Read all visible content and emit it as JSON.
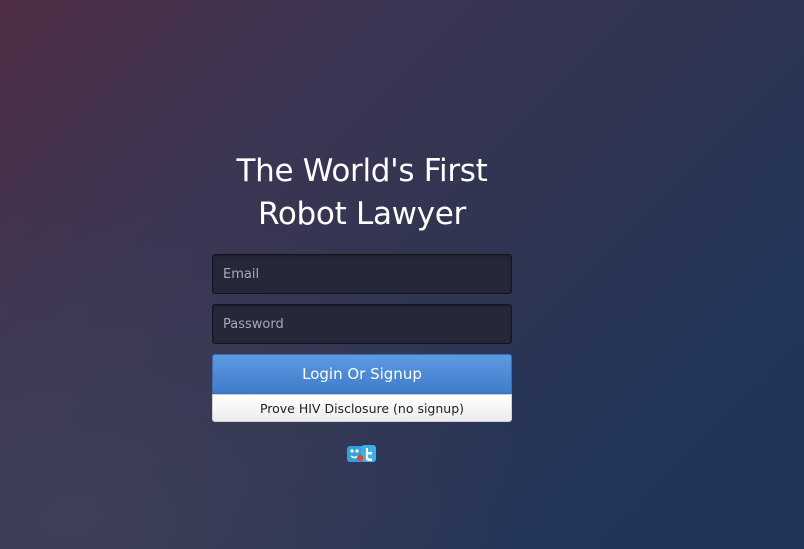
{
  "heading": {
    "line1": "The World's First",
    "line2": "Robot Lawyer"
  },
  "form": {
    "email_placeholder": "Email",
    "email_value": "",
    "password_placeholder": "Password",
    "password_value": "",
    "login_label": "Login Or Signup",
    "prove_label": "Prove HIV Disclosure (no signup)"
  },
  "social": {
    "icon": "twitter-login-icon",
    "colors": {
      "tile": "#2fa3dc",
      "bird": "#ffffff",
      "badge": "#e0463a"
    }
  },
  "colors": {
    "accent": "#4a8ad6",
    "text": "#ffffff"
  }
}
